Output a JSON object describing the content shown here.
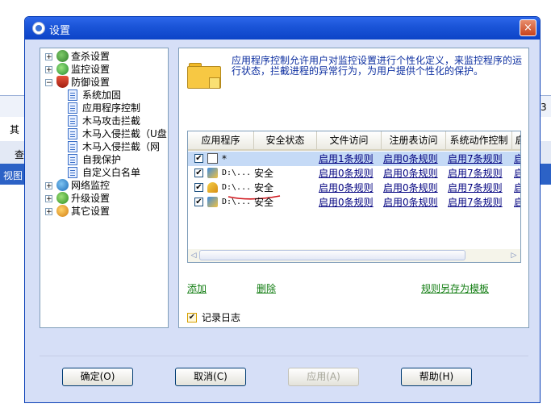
{
  "background": {
    "partial_text_1": "其",
    "partial_text_2": "查",
    "partial_text_3": "视图",
    "partial_text_4": "3"
  },
  "dialog": {
    "title": "设置",
    "close_glyph": "×"
  },
  "tree": {
    "items": [
      {
        "label": "查杀设置",
        "level": 0,
        "expander": "+"
      },
      {
        "label": "监控设置",
        "level": 0,
        "expander": "+"
      },
      {
        "label": "防御设置",
        "level": 0,
        "expander": "−"
      },
      {
        "label": "系统加固",
        "level": 1
      },
      {
        "label": "应用程序控制",
        "level": 1,
        "selected": true
      },
      {
        "label": "木马攻击拦截",
        "level": 1
      },
      {
        "label": "木马入侵拦截（U盘",
        "level": 1
      },
      {
        "label": "木马入侵拦截（网",
        "level": 1
      },
      {
        "label": "自我保护",
        "level": 1
      },
      {
        "label": "自定义白名单",
        "level": 1
      },
      {
        "label": "网络监控",
        "level": 0,
        "expander": "+"
      },
      {
        "label": "升级设置",
        "level": 0,
        "expander": "+"
      },
      {
        "label": "其它设置",
        "level": 0,
        "expander": "+"
      }
    ]
  },
  "content": {
    "description": "应用程序控制允许用户对监控设置进行个性化定义，来监控程序的运行状态，拦截进程的异常行为，为用户提供个性化的保护。",
    "table": {
      "headers": [
        "应用程序",
        "安全状态",
        "文件访问",
        "注册表访问",
        "系统动作控制",
        "启"
      ],
      "rows": [
        {
          "checked": "✔",
          "app": "*",
          "status": "",
          "file": "启用1条规则",
          "reg": "启用0条规则",
          "sys": "启用7条规则",
          "more": "启",
          "selected": true
        },
        {
          "checked": "✔",
          "app": "D:\\...",
          "status": "安全",
          "file": "启用0条规则",
          "reg": "启用0条规则",
          "sys": "启用7条规则",
          "more": "启"
        },
        {
          "checked": "✔",
          "app": "D:\\...",
          "status": "安全",
          "file": "启用0条规则",
          "reg": "启用0条规则",
          "sys": "启用7条规则",
          "more": "启"
        },
        {
          "checked": "✔",
          "app": "D:\\...",
          "status": "安全",
          "file": "启用0条规则",
          "reg": "启用0条规则",
          "sys": "启用7条规则",
          "more": "启"
        }
      ]
    },
    "actions": {
      "add": "添加",
      "delete": "删除",
      "save_template": "规则另存为模板"
    },
    "log_checkbox": {
      "checked": "✔",
      "label": "记录日志"
    }
  },
  "buttons": {
    "ok": "确定(O)",
    "cancel": "取消(C)",
    "apply": "应用(A)",
    "help": "帮助(H)"
  }
}
